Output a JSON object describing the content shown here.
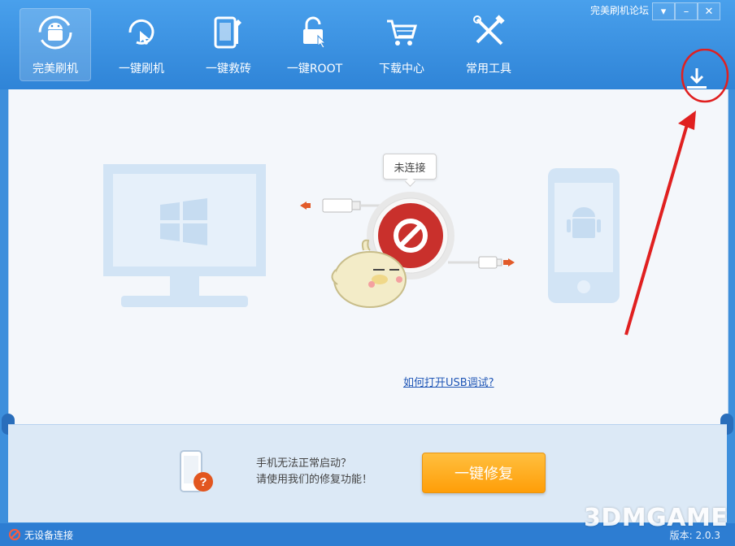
{
  "window": {
    "forum_link": "完美刷机论坛",
    "controls": {
      "menu": "▾",
      "minimize": "–",
      "close": "✕"
    }
  },
  "nav": {
    "tabs": [
      {
        "label": "完美刷机",
        "icon": "android-refresh-icon",
        "active": true
      },
      {
        "label": "一键刷机",
        "icon": "touch-flash-icon",
        "active": false
      },
      {
        "label": "一键救砖",
        "icon": "brick-repair-icon",
        "active": false
      },
      {
        "label": "一键ROOT",
        "icon": "unlock-icon",
        "active": false
      },
      {
        "label": "下载中心",
        "icon": "cart-icon",
        "active": false
      },
      {
        "label": "常用工具",
        "icon": "tools-icon",
        "active": false
      }
    ]
  },
  "connection": {
    "status": "未连接",
    "usb_help_link": "如何打开USB调试?"
  },
  "repair": {
    "line1": "手机无法正常启动？",
    "line2": "请使用我们的修复功能！",
    "button": "一键修复"
  },
  "statusbar": {
    "device_status": "无设备连接",
    "version_label": "版本: 2.0.3"
  },
  "watermark": "3DMGAME",
  "colors": {
    "brand_blue": "#3d8fdc",
    "content_bg": "#f4f7fb",
    "repair_orange": "#ff9e08",
    "disconnect_red": "#c9302c",
    "annotation_red": "#e02020"
  }
}
